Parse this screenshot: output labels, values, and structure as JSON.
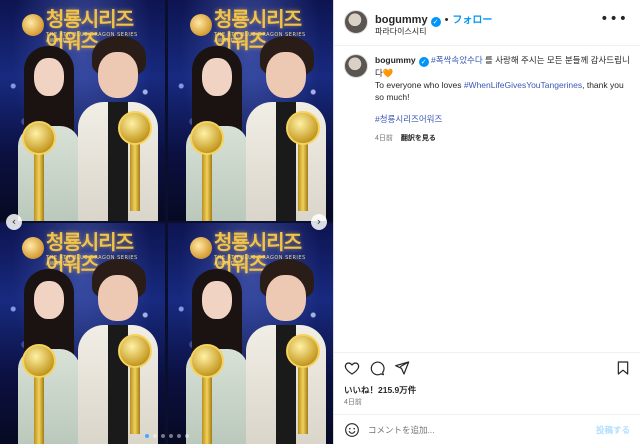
{
  "post": {
    "logo_text": "청룡시리즈어워즈",
    "logo_sub": "THE 4TH BLUE DRAGON SERIES AWARDS",
    "carousel_dots": 6,
    "active_dot": 0
  },
  "header": {
    "username": "bogummy",
    "follow_label": "フォロー",
    "separator": "•",
    "location": "파라다이스시티",
    "more_label": "•••"
  },
  "caption": {
    "username": "bogummy",
    "part1_hashtag": "#폭싹속았수다",
    "part1_text": " 를 사랑해 주시는 모든 분들께 감사드립니다🧡",
    "part2_text": "To everyone who loves ",
    "part2_hashtag": "#WhenLifeGivesYouTangerines",
    "part2_end": ", thank you so much!",
    "tag": "#청룡시리즈어워즈",
    "time": "4日前",
    "translate": "翻訳を見る"
  },
  "actions": {
    "icons": [
      "heart-icon",
      "comment-icon",
      "share-icon",
      "bookmark-icon"
    ]
  },
  "stats": {
    "likes": "いいね！215.9万件",
    "date": "4日前"
  },
  "comment": {
    "placeholder": "コメントを追加...",
    "post_label": "投稿する"
  },
  "colors": {
    "accent": "#0095f6",
    "hashtag": "#3a59b8",
    "post_disabled": "#b2dffc"
  }
}
